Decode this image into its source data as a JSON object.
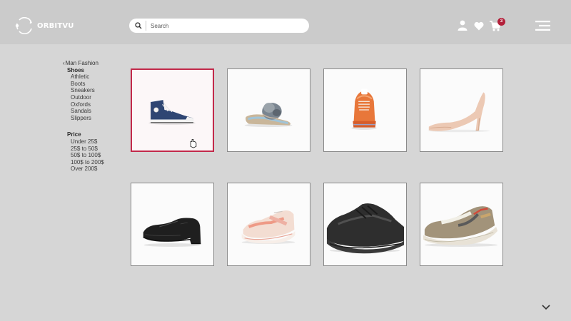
{
  "brand": {
    "name": "ORBITVU"
  },
  "search": {
    "placeholder": "Search"
  },
  "header": {
    "cart_count": "3"
  },
  "sidebar": {
    "breadcrumb": "Man Fashion",
    "shoes_heading": "Shoes",
    "shoes": [
      "Athletic",
      "Boots",
      "Sneakers",
      "Outdoor",
      "Oxfords",
      "Sandals",
      "Slippers"
    ],
    "price_heading": "Price",
    "prices": [
      "Under 25$",
      "25$ to 50$",
      "50$ to 100$",
      "100$ to 200$",
      "Over 200$"
    ]
  },
  "products": [
    {
      "kind": "high-top-sneaker",
      "color": "#2f4673",
      "selected": true
    },
    {
      "kind": "fur-slide-sandal",
      "color": "#7a8590",
      "selected": false
    },
    {
      "kind": "running-shoe",
      "color": "#e8773a",
      "selected": false
    },
    {
      "kind": "stiletto-pump",
      "color": "#ecc9b4",
      "selected": false
    },
    {
      "kind": "oxford-shoe",
      "color": "#1f1f1f",
      "selected": false
    },
    {
      "kind": "chunky-sneaker",
      "color": "#eeb0a3",
      "selected": false
    },
    {
      "kind": "hiking-shoe",
      "color": "#2e2e2e",
      "selected": false
    },
    {
      "kind": "retro-sneaker",
      "color": "#8a8a6a",
      "selected": false
    }
  ],
  "colors": {
    "accent": "#c2294a",
    "badge": "#b3203a",
    "header_bg": "#cbcbcb",
    "page_bg": "#d6d6d6"
  }
}
